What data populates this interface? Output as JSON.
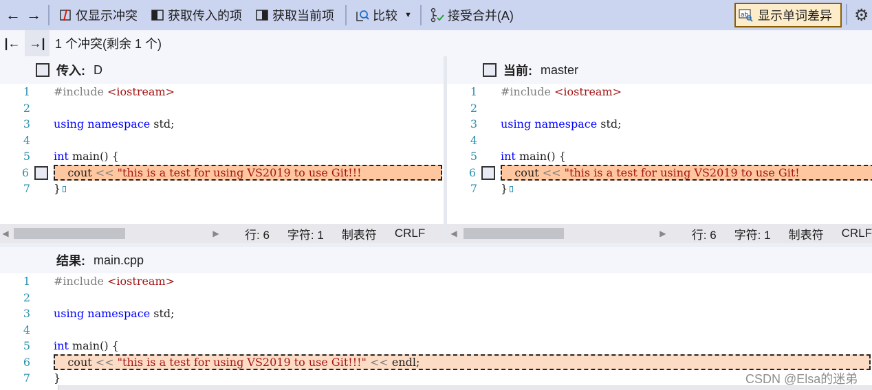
{
  "toolbar": {
    "back_icon": "arrow-left",
    "forward_icon": "arrow-right",
    "show_conflicts_only": "仅显示冲突",
    "take_incoming": "获取传入的项",
    "take_current": "获取当前项",
    "compare": "比较",
    "accept_merge": "接受合并(A)",
    "show_word_diff": "显示单词差异",
    "settings_icon": "gear"
  },
  "conflict_nav": {
    "prev_icon": "first-conflict",
    "next_icon": "next-conflict",
    "summary": "1 个冲突(剩余 1 个)"
  },
  "incoming": {
    "label": "传入:",
    "branch": "D",
    "lines": [
      {
        "n": "1"
      },
      {
        "n": "2"
      },
      {
        "n": "3"
      },
      {
        "n": "4"
      },
      {
        "n": "5"
      },
      {
        "n": "6"
      },
      {
        "n": "7"
      }
    ],
    "code": {
      "l1_pp": "#include ",
      "l1_inc": "<iostream>",
      "l3_kw1": "using",
      "l3_kw2": "namespace",
      "l3_rest": " std;",
      "l5_kw": "int",
      "l5_rest": " main() {",
      "l6_a": "    cout ",
      "l6_op": "<<",
      "l6_str": " \"this is a test for using VS2019 to use Git!!!",
      "l7": "}"
    },
    "status": {
      "line": "行: 6",
      "char": "字符: 1",
      "tabs": "制表符",
      "eol": "CRLF"
    }
  },
  "current": {
    "label": "当前:",
    "branch": "master",
    "code": {
      "l6_str": " \"this is a test for using VS2019 to use Git!"
    },
    "status": {
      "line": "行: 6",
      "char": "字符: 1",
      "tabs": "制表符",
      "eol": "CRLF"
    }
  },
  "result": {
    "label": "结果:",
    "file": "main.cpp",
    "code": {
      "l6_str": " \"this is a test for using VS2019 to use Git!!!\"",
      "l6_op2": " <<",
      "l6_end": " endl;"
    }
  },
  "watermark": "CSDN @Elsa的迷弟",
  "colors": {
    "toolbar_bg": "#ccd5f0",
    "conflict_highlight": "#ffc7a0",
    "result_highlight": "#fddcc6",
    "keyword": "#0000ff",
    "string": "#a31515",
    "line_number": "#2b91af",
    "word_diff_active": "#fdecc9"
  }
}
